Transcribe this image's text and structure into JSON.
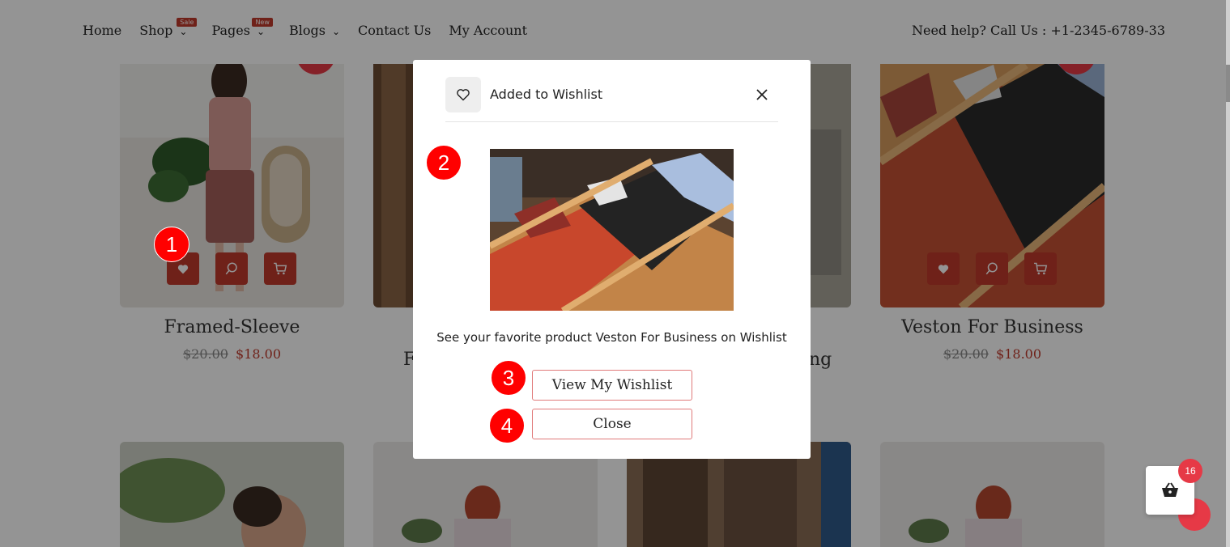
{
  "nav": {
    "items": [
      {
        "label": "Home"
      },
      {
        "label": "Shop",
        "badge": "Sale",
        "has_dropdown": true
      },
      {
        "label": "Pages",
        "badge": "New",
        "has_dropdown": true
      },
      {
        "label": "Blogs",
        "has_dropdown": true
      },
      {
        "label": "Contact Us"
      },
      {
        "label": "My Account"
      }
    ],
    "help_text": "Need help? Call Us : +1-2345-6789-33"
  },
  "products": [
    {
      "title": "Framed-Sleeve",
      "old_price": "$20.00",
      "new_price": "$18.00"
    },
    {
      "title_fragment": "F"
    },
    {
      "title_fragment": "ng"
    },
    {
      "title": "Veston For Business",
      "old_price": "$20.00",
      "new_price": "$18.00"
    }
  ],
  "modal": {
    "title": "Added to Wishlist",
    "message": "See your favorite product Veston For Business on Wishlist",
    "view_button": "View My Wishlist",
    "close_button": "Close"
  },
  "markers": [
    "1",
    "2",
    "3",
    "4"
  ],
  "cart": {
    "count": "16"
  },
  "colors": {
    "accent": "#c0392b",
    "badge": "#e63946",
    "marker": "#ff0000",
    "overlay": "rgba(0,0,0,0.42)"
  },
  "icons": [
    "heart-icon",
    "search-icon",
    "cart-icon",
    "close-icon",
    "basket-icon",
    "chevron-down-icon"
  ]
}
